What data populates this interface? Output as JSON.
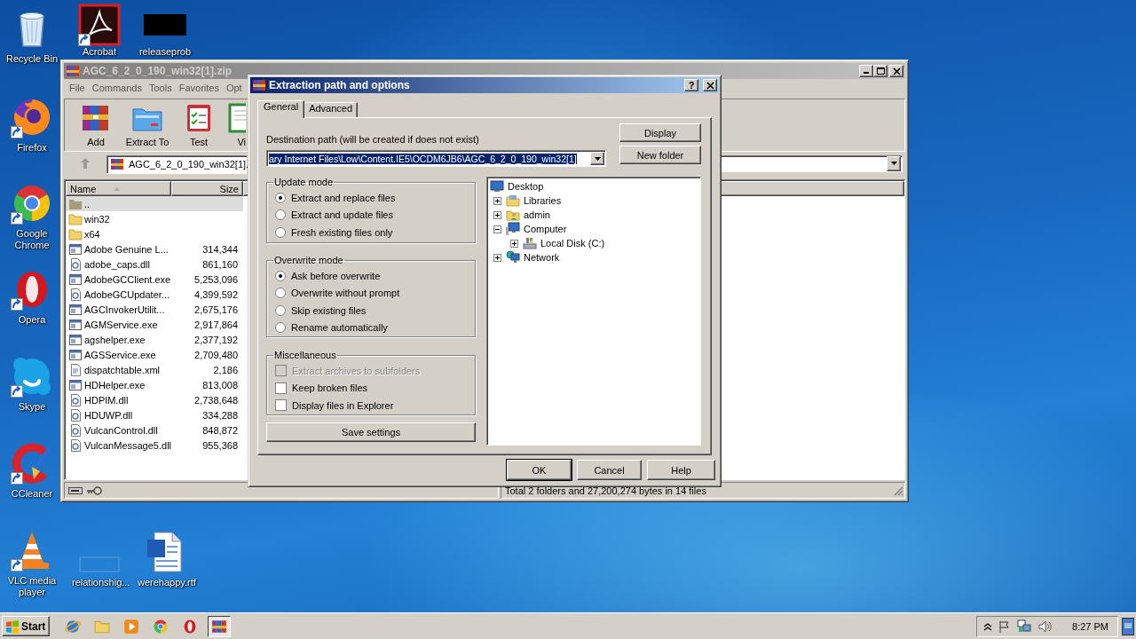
{
  "desktop": {
    "icons": [
      {
        "label": "Recycle Bin",
        "kind": "recycle",
        "shortcut": false
      },
      {
        "label": "Acrobat",
        "kind": "acrobat",
        "shortcut": true
      },
      {
        "label": "releaseprob",
        "kind": "thumbnail",
        "shortcut": false
      },
      {
        "label": "Firefox",
        "kind": "firefox",
        "shortcut": true
      },
      {
        "label": "Google Chrome",
        "kind": "chrome",
        "shortcut": true
      },
      {
        "label": "Opera",
        "kind": "opera",
        "shortcut": true
      },
      {
        "label": "Skype",
        "kind": "skype",
        "shortcut": true
      },
      {
        "label": "CCleaner",
        "kind": "ccleaner",
        "shortcut": true
      },
      {
        "label": "VLC media player",
        "kind": "vlc",
        "shortcut": true
      },
      {
        "label": "relationshig...",
        "kind": "blank",
        "shortcut": false
      },
      {
        "label": "werehappy.rtf",
        "kind": "word",
        "shortcut": false
      }
    ]
  },
  "winrar": {
    "title": "AGC_6_2_0_190_win32[1].zip",
    "menu": [
      "File",
      "Commands",
      "Tools",
      "Favorites",
      "Opt"
    ],
    "toolbar": [
      {
        "label": "Add",
        "kind": "add"
      },
      {
        "label": "Extract To",
        "kind": "extract"
      },
      {
        "label": "Test",
        "kind": "test"
      },
      {
        "label": "Vi",
        "kind": "view"
      }
    ],
    "address": "AGC_6_2_0_190_win32[1].",
    "columns": [
      "Name",
      "Size"
    ],
    "rows": [
      {
        "name": "..",
        "size": "",
        "kind": "up",
        "selected": true
      },
      {
        "name": "win32",
        "size": "",
        "kind": "folder",
        "selected": false
      },
      {
        "name": "x64",
        "size": "",
        "kind": "folder",
        "selected": false
      },
      {
        "name": "Adobe Genuine L...",
        "size": "314,344",
        "kind": "exe",
        "selected": false
      },
      {
        "name": "adobe_caps.dll",
        "size": "861,160",
        "kind": "dll",
        "selected": false
      },
      {
        "name": "AdobeGCClient.exe",
        "size": "5,253,096",
        "kind": "exe",
        "selected": false
      },
      {
        "name": "AdobeGCUpdater...",
        "size": "4,399,592",
        "kind": "dll",
        "selected": false
      },
      {
        "name": "AGCInvokerUtilit...",
        "size": "2,675,176",
        "kind": "exe",
        "selected": false
      },
      {
        "name": "AGMService.exe",
        "size": "2,917,864",
        "kind": "exe",
        "selected": false
      },
      {
        "name": "agshelper.exe",
        "size": "2,377,192",
        "kind": "exe",
        "selected": false
      },
      {
        "name": "AGSService.exe",
        "size": "2,709,480",
        "kind": "exe",
        "selected": false
      },
      {
        "name": "dispatchtable.xml",
        "size": "2,186",
        "kind": "xml",
        "selected": false
      },
      {
        "name": "HDHelper.exe",
        "size": "813,008",
        "kind": "exe",
        "selected": false
      },
      {
        "name": "HDPIM.dll",
        "size": "2,738,648",
        "kind": "dll",
        "selected": false
      },
      {
        "name": "HDUWP.dll",
        "size": "334,288",
        "kind": "dll",
        "selected": false
      },
      {
        "name": "VulcanControl.dll",
        "size": "848,872",
        "kind": "dll",
        "selected": false
      },
      {
        "name": "VulcanMessage5.dll",
        "size": "955,368",
        "kind": "dll",
        "selected": false
      }
    ],
    "status": "Total 2 folders and 27,200,274 bytes in 14 files"
  },
  "dialog": {
    "title": "Extraction path and options",
    "help": "?",
    "tabs": [
      {
        "label": "General",
        "selected": true
      },
      {
        "label": "Advanced",
        "selected": false
      }
    ],
    "path_label": "Destination path (will be created if does not exist)",
    "path_value": "ary Internet Files\\Low\\Content.IE5\\OCDM6JB6\\AGC_6_2_0_190_win32[1]",
    "path_selected": true,
    "side_buttons": [
      "Display",
      "New folder"
    ],
    "groups": [
      {
        "title": "Update mode",
        "items": [
          {
            "label": "Extract and replace files",
            "kind": "radio",
            "checked": true,
            "disabled": false
          },
          {
            "label": "Extract and update files",
            "kind": "radio",
            "checked": false,
            "disabled": false
          },
          {
            "label": "Fresh existing files only",
            "kind": "radio",
            "checked": false,
            "disabled": false
          }
        ]
      },
      {
        "title": "Overwrite mode",
        "items": [
          {
            "label": "Ask before overwrite",
            "kind": "radio",
            "checked": true,
            "disabled": false
          },
          {
            "label": "Overwrite without prompt",
            "kind": "radio",
            "checked": false,
            "disabled": false
          },
          {
            "label": "Skip existing files",
            "kind": "radio",
            "checked": false,
            "disabled": false
          },
          {
            "label": "Rename automatically",
            "kind": "radio",
            "checked": false,
            "disabled": false
          }
        ]
      },
      {
        "title": "Miscellaneous",
        "items": [
          {
            "label": "Extract archives to subfolders",
            "kind": "checkbox",
            "checked": false,
            "disabled": true
          },
          {
            "label": "Keep broken files",
            "kind": "checkbox",
            "checked": false,
            "disabled": false
          },
          {
            "label": "Display files in Explorer",
            "kind": "checkbox",
            "checked": false,
            "disabled": false
          }
        ]
      }
    ],
    "save_button": "Save settings",
    "tree": [
      {
        "label": "Desktop",
        "kind": "desktop",
        "children": [
          {
            "label": "Libraries",
            "kind": "libraries",
            "expanded": false
          },
          {
            "label": "admin",
            "kind": "user",
            "expanded": false
          },
          {
            "label": "Computer",
            "kind": "computer",
            "expanded": true,
            "children": [
              {
                "label": "Local Disk (C:)",
                "kind": "disk",
                "expanded": false
              }
            ]
          },
          {
            "label": "Network",
            "kind": "network",
            "expanded": false
          }
        ]
      }
    ],
    "buttons": [
      {
        "label": "OK",
        "default": true
      },
      {
        "label": "Cancel",
        "default": false
      },
      {
        "label": "Help",
        "default": false
      }
    ]
  },
  "taskbar": {
    "start": "Start",
    "apps": [
      {
        "kind": "ie",
        "active": false
      },
      {
        "kind": "explorer",
        "active": false
      },
      {
        "kind": "mediaplayer",
        "active": false
      },
      {
        "kind": "chrome",
        "active": false
      },
      {
        "kind": "opera",
        "active": false
      },
      {
        "kind": "winrar",
        "active": true
      }
    ],
    "clock": "8:27 PM"
  }
}
